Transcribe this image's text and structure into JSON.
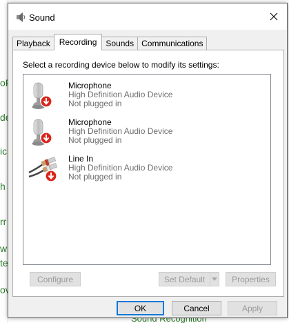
{
  "window": {
    "title": "Sound",
    "icon": "speaker-icon",
    "close_icon": "close-icon"
  },
  "tabs": [
    {
      "label": "Playback",
      "active": false
    },
    {
      "label": "Recording",
      "active": true
    },
    {
      "label": "Sounds",
      "active": false
    },
    {
      "label": "Communications",
      "active": false
    }
  ],
  "panel": {
    "instruction": "Select a recording device below to modify its settings:"
  },
  "devices": [
    {
      "name": "Microphone",
      "description": "High Definition Audio Device",
      "status": "Not plugged in",
      "icon": "microphone-icon",
      "badge": "unplugged-badge-icon"
    },
    {
      "name": "Microphone",
      "description": "High Definition Audio Device",
      "status": "Not plugged in",
      "icon": "microphone-icon",
      "badge": "unplugged-badge-icon"
    },
    {
      "name": "Line In",
      "description": "High Definition Audio Device",
      "status": "Not plugged in",
      "icon": "rca-cable-icon",
      "badge": "unplugged-badge-icon"
    }
  ],
  "buttons": {
    "configure": "Configure",
    "set_default": "Set Default",
    "properties": "Properties",
    "ok": "OK",
    "cancel": "Cancel",
    "apply": "Apply"
  },
  "colors": {
    "accent": "#0078d7",
    "badge_red": "#d9251c",
    "disabled_text": "#9a9a9a",
    "background_text": "#2a7a2a"
  },
  "background": {
    "left_fragments": [
      "oP",
      "de",
      "ic",
      "h",
      "rr",
      "w",
      "te",
      "ov"
    ],
    "bottom_fragment": "Sound Recognition"
  }
}
